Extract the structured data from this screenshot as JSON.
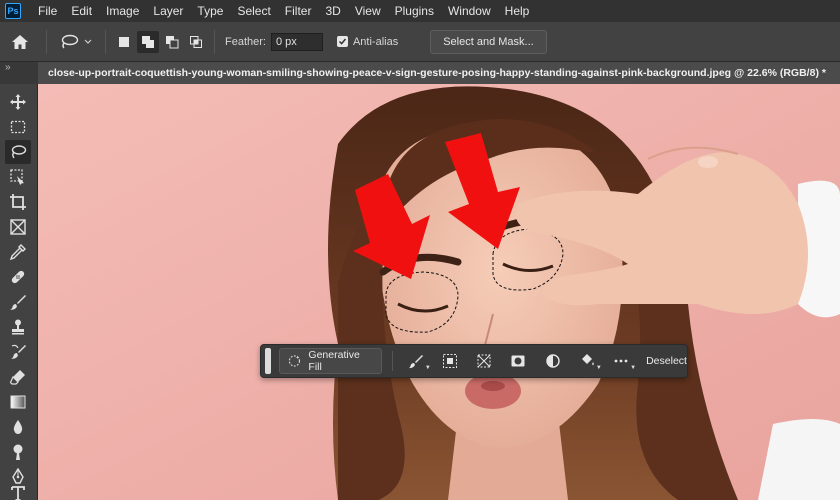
{
  "app": {
    "logo_text": "Ps"
  },
  "menu": [
    "File",
    "Edit",
    "Image",
    "Layer",
    "Type",
    "Select",
    "Filter",
    "3D",
    "View",
    "Plugins",
    "Window",
    "Help"
  ],
  "options_bar": {
    "home_icon": "home-icon",
    "tool_icon": "lasso-icon",
    "feather_label": "Feather:",
    "feather_value": "0 px",
    "anti_alias_label": "Anti-alias",
    "anti_alias_checked": true,
    "select_and_mask_label": "Select and Mask..."
  },
  "tabs": {
    "toggle": "»",
    "document_title": "close-up-portrait-coquettish-young-woman-smiling-showing-peace-v-sign-gesture-posing-happy-standing-against-pink-background.jpeg @ 22.6% (RGB/8) *"
  },
  "toolbar": {
    "tools": [
      "move-tool",
      "marquee-tool",
      "lasso-tool",
      "object-selection-tool",
      "crop-tool",
      "frame-tool",
      "eyedropper-tool",
      "healing-brush-tool",
      "brush-tool",
      "clone-stamp-tool",
      "history-brush-tool",
      "eraser-tool",
      "gradient-tool",
      "blur-tool",
      "dodge-tool",
      "pen-tool",
      "type-tool"
    ],
    "active_tool": "lasso-tool"
  },
  "canvas": {
    "background_color": "#efb0ac",
    "annotation_color": "#f01010"
  },
  "context_bar": {
    "generative_fill_label": "Generative Fill",
    "deselect_label": "Deselect",
    "icons": [
      "modify-selection-icon",
      "invert-selection-icon",
      "transform-selection-icon",
      "mask-icon",
      "adjustment-layer-icon",
      "fill-icon",
      "more-options-icon"
    ]
  }
}
